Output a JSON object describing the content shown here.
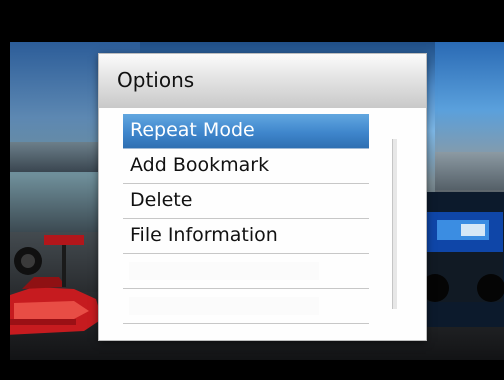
{
  "dialog": {
    "title": "Options",
    "items": [
      {
        "label": "Repeat Mode",
        "selected": true
      },
      {
        "label": "Add Bookmark",
        "selected": false
      },
      {
        "label": "Delete",
        "selected": false
      },
      {
        "label": "File Information",
        "selected": false
      },
      {
        "label": "",
        "selected": false
      },
      {
        "label": "",
        "selected": false
      }
    ]
  },
  "colors": {
    "selection_accent": "#3f86cc",
    "dialog_background": "#fefefe",
    "header_gradient_bottom": "#c9c9c9"
  }
}
